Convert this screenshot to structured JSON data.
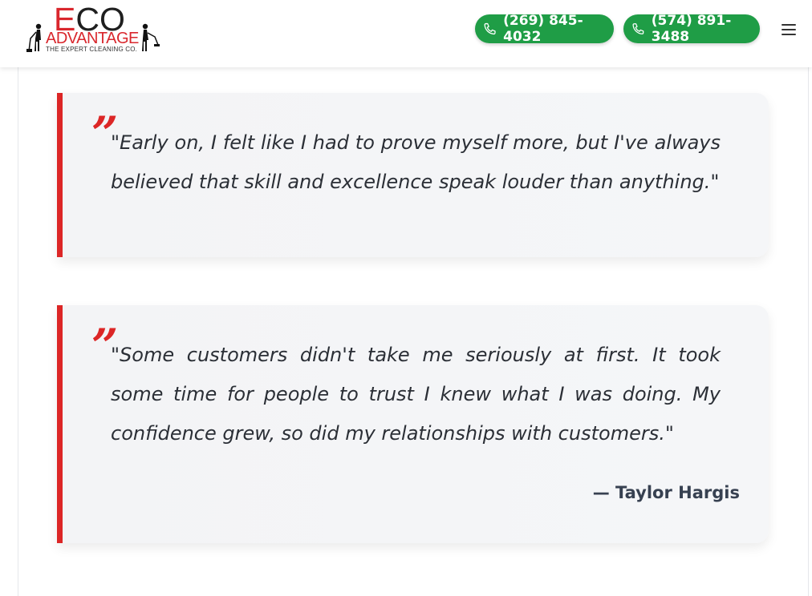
{
  "header": {
    "logo": {
      "eco_first": "E",
      "eco_rest": "CO",
      "advantage": "ADVANTAGE",
      "tagline": "THE EXPERT CLEANING CO."
    },
    "phones": [
      {
        "label": "(269) 845-4032",
        "icon": "phone-icon"
      },
      {
        "label": "(574) 891-3488",
        "icon": "phone-icon"
      }
    ],
    "menu_icon": "hamburger-menu-icon"
  },
  "testimonials": [
    {
      "quote_mark": "”",
      "text": "\"Early on, I felt like I had to prove myself more, but I've always believed that skill and excellence speak louder than anything.\""
    },
    {
      "quote_mark": "”",
      "text": "\"Some customers didn't take me seriously at first. It took some time for people to trust I knew what I was doing. My confidence grew, so did my relationships with customers.\"",
      "author": "— Taylor Hargis"
    }
  ],
  "colors": {
    "accent_red": "#dc2626",
    "phone_green": "#1f9d46",
    "card_bg": "#f3f4f6",
    "text": "#2b2f36"
  }
}
